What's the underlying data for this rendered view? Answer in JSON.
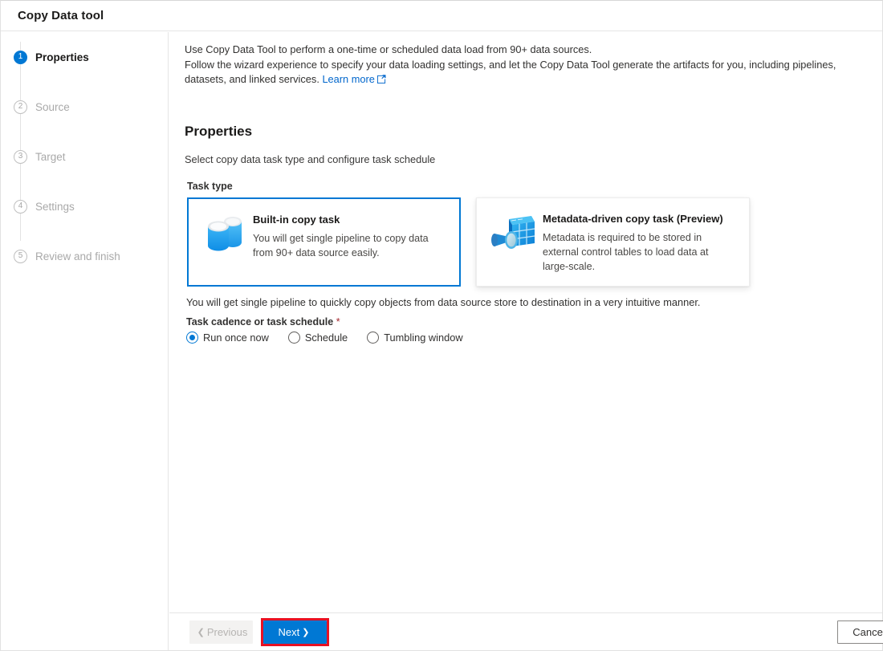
{
  "header": {
    "title": "Copy Data tool"
  },
  "sidebar": {
    "steps": [
      {
        "num": "1",
        "label": "Properties",
        "state": "active"
      },
      {
        "num": "2",
        "label": "Source",
        "state": "inactive"
      },
      {
        "num": "3",
        "label": "Target",
        "state": "inactive"
      },
      {
        "num": "4",
        "label": "Settings",
        "state": "inactive"
      },
      {
        "num": "5",
        "label": "Review and finish",
        "state": "inactive"
      }
    ]
  },
  "main": {
    "intro_line1": "Use Copy Data Tool to perform a one-time or scheduled data load from 90+ data sources.",
    "intro_line2": "Follow the wizard experience to specify your data loading settings, and let the Copy Data Tool generate the artifacts for you, including pipelines, datasets, and linked services. ",
    "learn_more_label": "Learn more",
    "learn_more_icon": "external-link-icon",
    "section_title": "Properties",
    "section_subtitle": "Select copy data task type and configure task schedule",
    "task_type_label": "Task type",
    "cards": [
      {
        "title": "Built-in copy task",
        "description": "You will get single pipeline to copy data from 90+ data source easily.",
        "icon": "database-cylinders-icon",
        "selected": true
      },
      {
        "title": "Metadata-driven copy task (Preview)",
        "description": "Metadata is required to be stored in external control tables to load data at large-scale.",
        "icon": "metadata-table-magnifier-icon",
        "selected": false
      }
    ],
    "card_note": "You will get single pipeline to quickly copy objects from data source store to destination in a very intuitive manner.",
    "cadence_label": "Task cadence or task schedule",
    "cadence_required_mark": "*",
    "cadence_options": [
      {
        "label": "Run once now",
        "checked": true
      },
      {
        "label": "Schedule",
        "checked": false
      },
      {
        "label": "Tumbling window",
        "checked": false
      }
    ]
  },
  "footer": {
    "previous_label": "Previous",
    "previous_chevron": "chevron-left-icon",
    "next_label": "Next",
    "next_chevron": "chevron-right-icon",
    "cancel_label": "Cancel"
  },
  "colors": {
    "accent": "#0078d4",
    "highlight": "#e81123",
    "link": "#0066cc",
    "required": "#a4262c"
  }
}
